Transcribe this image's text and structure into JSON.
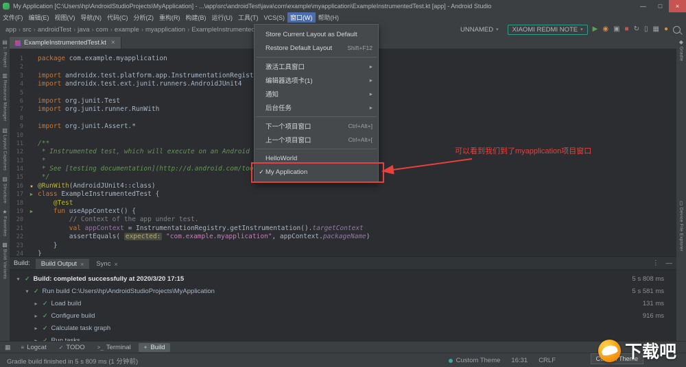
{
  "window": {
    "title": "My Application [C:\\Users\\hp\\AndroidStudioProjects\\MyApplication] - ...\\app\\src\\androidTest\\java\\com\\example\\myapplication\\ExampleInstrumentedTest.kt [app] - Android Studio",
    "controls": {
      "minimize": "—",
      "maximize": "□",
      "close": "×"
    }
  },
  "colors": {
    "accent_blue": "#4b6eaf",
    "annotation_red": "#e8413c",
    "run_green": "#5f9e59",
    "success_green": "#57965c",
    "device_border_teal": "#2e9d8e"
  },
  "menu_bar": {
    "active_index": 11,
    "items": [
      "文件(F)",
      "编辑(E)",
      "视图(V)",
      "导航(N)",
      "代码(C)",
      "分析(Z)",
      "重构(R)",
      "构建(B)",
      "运行(U)",
      "工具(T)",
      "VCS(S)",
      "窗口(W)",
      "帮助(H)"
    ]
  },
  "breadcrumbs": {
    "separator": "›",
    "items": [
      "app",
      "src",
      "androidTest",
      "java",
      "com",
      "example",
      "myapplication",
      "ExampleInstrumentedTest.kt"
    ]
  },
  "run_toolbar": {
    "config": "UNNAMED",
    "device": "XIAOMI REDMI NOTE",
    "chevron": "▾",
    "icons": [
      {
        "name": "run-icon",
        "glyph": "▶",
        "color": "#5f9e59"
      },
      {
        "name": "profile-icon",
        "glyph": "◉",
        "color": "#d98e42"
      },
      {
        "name": "debug-icon",
        "glyph": "▣",
        "color": "#9da1a6"
      },
      {
        "name": "stop-icon",
        "glyph": "■",
        "color": "#c75450"
      },
      {
        "name": "sync-project-icon",
        "glyph": "↻",
        "color": "#9da1a6"
      },
      {
        "name": "device-manager-icon",
        "glyph": "▯",
        "color": "#9da1a6"
      },
      {
        "name": "layout-inspector-icon",
        "glyph": "▦",
        "color": "#9da1a6"
      },
      {
        "name": "notifications-icon",
        "glyph": "●",
        "color": "#d98e42"
      }
    ]
  },
  "window_menu": {
    "items": [
      {
        "label": "Store Current Layout as Default"
      },
      {
        "label": "Restore Default Layout",
        "shortcut": "Shift+F12"
      },
      {
        "separator": true
      },
      {
        "label": "激活工具窗口",
        "submenu": true
      },
      {
        "label": "编辑器选项卡(1)",
        "submenu": true
      },
      {
        "label": "通知",
        "submenu": true
      },
      {
        "label": "后台任务",
        "submenu": true
      },
      {
        "separator": true
      },
      {
        "label": "下一个项目窗口",
        "shortcut": "Ctrl+Alt+]"
      },
      {
        "label": "上一个项目窗口",
        "shortcut": "Ctrl+Alt+["
      },
      {
        "separator": true
      },
      {
        "label": "HelloWorld"
      },
      {
        "label": "My Application",
        "checked": true
      }
    ]
  },
  "annotation": {
    "text": "可以看到我们到了myapplication项目窗口"
  },
  "editor": {
    "tab": {
      "title": "ExampleInstrumentedTest.kt",
      "close": "×"
    },
    "lines": [
      {
        "n": 1,
        "t": [
          [
            "k",
            "package"
          ],
          [
            "p",
            " com.example.myapplication"
          ]
        ]
      },
      {
        "n": 2,
        "t": []
      },
      {
        "n": 3,
        "t": [
          [
            "k",
            "import"
          ],
          [
            "p",
            " androidx.test.platform.app.InstrumentationRegistry"
          ]
        ]
      },
      {
        "n": 4,
        "t": [
          [
            "k",
            "import"
          ],
          [
            "p",
            " androidx.test.ext.junit.runners.AndroidJUnit4"
          ]
        ]
      },
      {
        "n": 5,
        "t": []
      },
      {
        "n": 6,
        "t": [
          [
            "k",
            "import"
          ],
          [
            "p",
            " org.junit.Test"
          ]
        ]
      },
      {
        "n": 7,
        "t": [
          [
            "k",
            "import"
          ],
          [
            "p",
            " org.junit.runner.RunWith"
          ]
        ]
      },
      {
        "n": 8,
        "t": []
      },
      {
        "n": 9,
        "t": [
          [
            "k",
            "import"
          ],
          [
            "p",
            " org.junit.Assert.*"
          ]
        ]
      },
      {
        "n": 10,
        "t": []
      },
      {
        "n": 11,
        "t": [
          [
            "d",
            "/**"
          ]
        ]
      },
      {
        "n": 12,
        "t": [
          [
            "d",
            " * Instrumented test, which will execute on an Android device."
          ]
        ]
      },
      {
        "n": 13,
        "t": [
          [
            "d",
            " *"
          ]
        ]
      },
      {
        "n": 14,
        "t": [
          [
            "d",
            " * See [testing documentation](http://d.android.com/tools/testing)."
          ]
        ]
      },
      {
        "n": 15,
        "t": [
          [
            "d",
            " */"
          ]
        ]
      },
      {
        "n": 16,
        "g": "star",
        "t": [
          [
            "a",
            "@RunWith"
          ],
          [
            "p",
            "(AndroidJUnit4::class)"
          ]
        ]
      },
      {
        "n": 17,
        "g": "run",
        "t": [
          [
            "k",
            "class"
          ],
          [
            "p",
            " ExampleInstrumentedTest {"
          ]
        ]
      },
      {
        "n": 18,
        "t": [
          [
            "p",
            "    "
          ],
          [
            "a",
            "@Test"
          ]
        ]
      },
      {
        "n": 19,
        "g": "run",
        "t": [
          [
            "p",
            "    "
          ],
          [
            "k",
            "fun"
          ],
          [
            "p",
            " useAppContext() {"
          ]
        ]
      },
      {
        "n": 20,
        "t": [
          [
            "p",
            "        "
          ],
          [
            "c",
            "// Context of the app under test."
          ]
        ]
      },
      {
        "n": 21,
        "t": [
          [
            "p",
            "        "
          ],
          [
            "k",
            "val"
          ],
          [
            "v",
            " appContext"
          ],
          [
            "p",
            " = InstrumentationRegistry.getInstrumentation()."
          ],
          [
            "f",
            "targetContext"
          ]
        ]
      },
      {
        "n": 22,
        "t": [
          [
            "p",
            "        assertEquals( "
          ],
          [
            "h",
            "expected:"
          ],
          [
            "s",
            " \"com.example.myapplication\""
          ],
          [
            "p",
            ", appContext."
          ],
          [
            "f",
            "packageName"
          ],
          [
            "p",
            ")"
          ]
        ]
      },
      {
        "n": 23,
        "t": [
          [
            "p",
            "    }"
          ]
        ]
      },
      {
        "n": 24,
        "t": [
          [
            "p",
            "}"
          ]
        ]
      }
    ]
  },
  "left_strip": [
    {
      "icon": "project-icon",
      "glyph": "▤",
      "label": "1: Project"
    },
    {
      "icon": "resource-manager-icon",
      "glyph": "▥",
      "label": "Resource Manager"
    },
    {
      "icon": "layout-captures-icon",
      "glyph": "▧",
      "label": "Layout Captures"
    },
    {
      "icon": "structure-icon",
      "glyph": "▨",
      "label": "Structure"
    },
    {
      "icon": "favorites-icon",
      "glyph": "★",
      "label": "Favorites"
    },
    {
      "icon": "build-variants-icon",
      "glyph": "▩",
      "label": "Build Variants"
    }
  ],
  "right_strip": [
    {
      "icon": "gradle-icon",
      "glyph": "◆",
      "label": "Gradle"
    },
    {
      "icon": "device-file-explorer-icon",
      "glyph": "▯",
      "label": "Device File Explorer",
      "pushed": true
    }
  ],
  "build_panel": {
    "label": "Build:",
    "more_icon": "⋮",
    "hide_icon": "—",
    "tabs": [
      {
        "label": "Build Output",
        "close": "×",
        "active": true
      },
      {
        "label": "Sync",
        "close": "×"
      }
    ],
    "rows": [
      {
        "indent": 0,
        "chevron": "▾",
        "text": "Build: completed successfully at 2020/3/20 17:15",
        "time": "5 s 808 ms",
        "bold": true
      },
      {
        "indent": 1,
        "chevron": "▾",
        "text": "Run build C:\\Users\\hp\\AndroidStudioProjects\\MyApplication",
        "time": "5 s 581 ms"
      },
      {
        "indent": 2,
        "chevron": "▸",
        "text": "Load build",
        "time": "131 ms"
      },
      {
        "indent": 2,
        "chevron": "▸",
        "text": "Configure build",
        "time": "916 ms"
      },
      {
        "indent": 2,
        "chevron": "▸",
        "text": "Calculate task graph",
        "time": ""
      },
      {
        "indent": 2,
        "chevron": "▸",
        "text": "Run tasks",
        "time": ""
      }
    ]
  },
  "bottom_bar": {
    "corner_glyph": "▦",
    "items": [
      {
        "icon": "logcat-icon",
        "glyph": "≡",
        "label": "Logcat"
      },
      {
        "icon": "todo-icon",
        "glyph": "✓",
        "label": "TODO"
      },
      {
        "icon": "terminal-icon",
        "glyph": ">_",
        "label": "Terminal"
      },
      {
        "icon": "build-icon",
        "glyph": "✦",
        "label": "Build",
        "active": true
      }
    ]
  },
  "status_bar": {
    "left": {
      "text": "Gradle build finished in 5 s 809 ms (1 分钟前)"
    },
    "right": [
      {
        "label": "Custom Theme",
        "dot": true
      },
      {
        "label": "16:31"
      },
      {
        "label": "CRLF"
      }
    ],
    "badge": "Custom Theme"
  },
  "watermark": {
    "text": "下载吧"
  }
}
